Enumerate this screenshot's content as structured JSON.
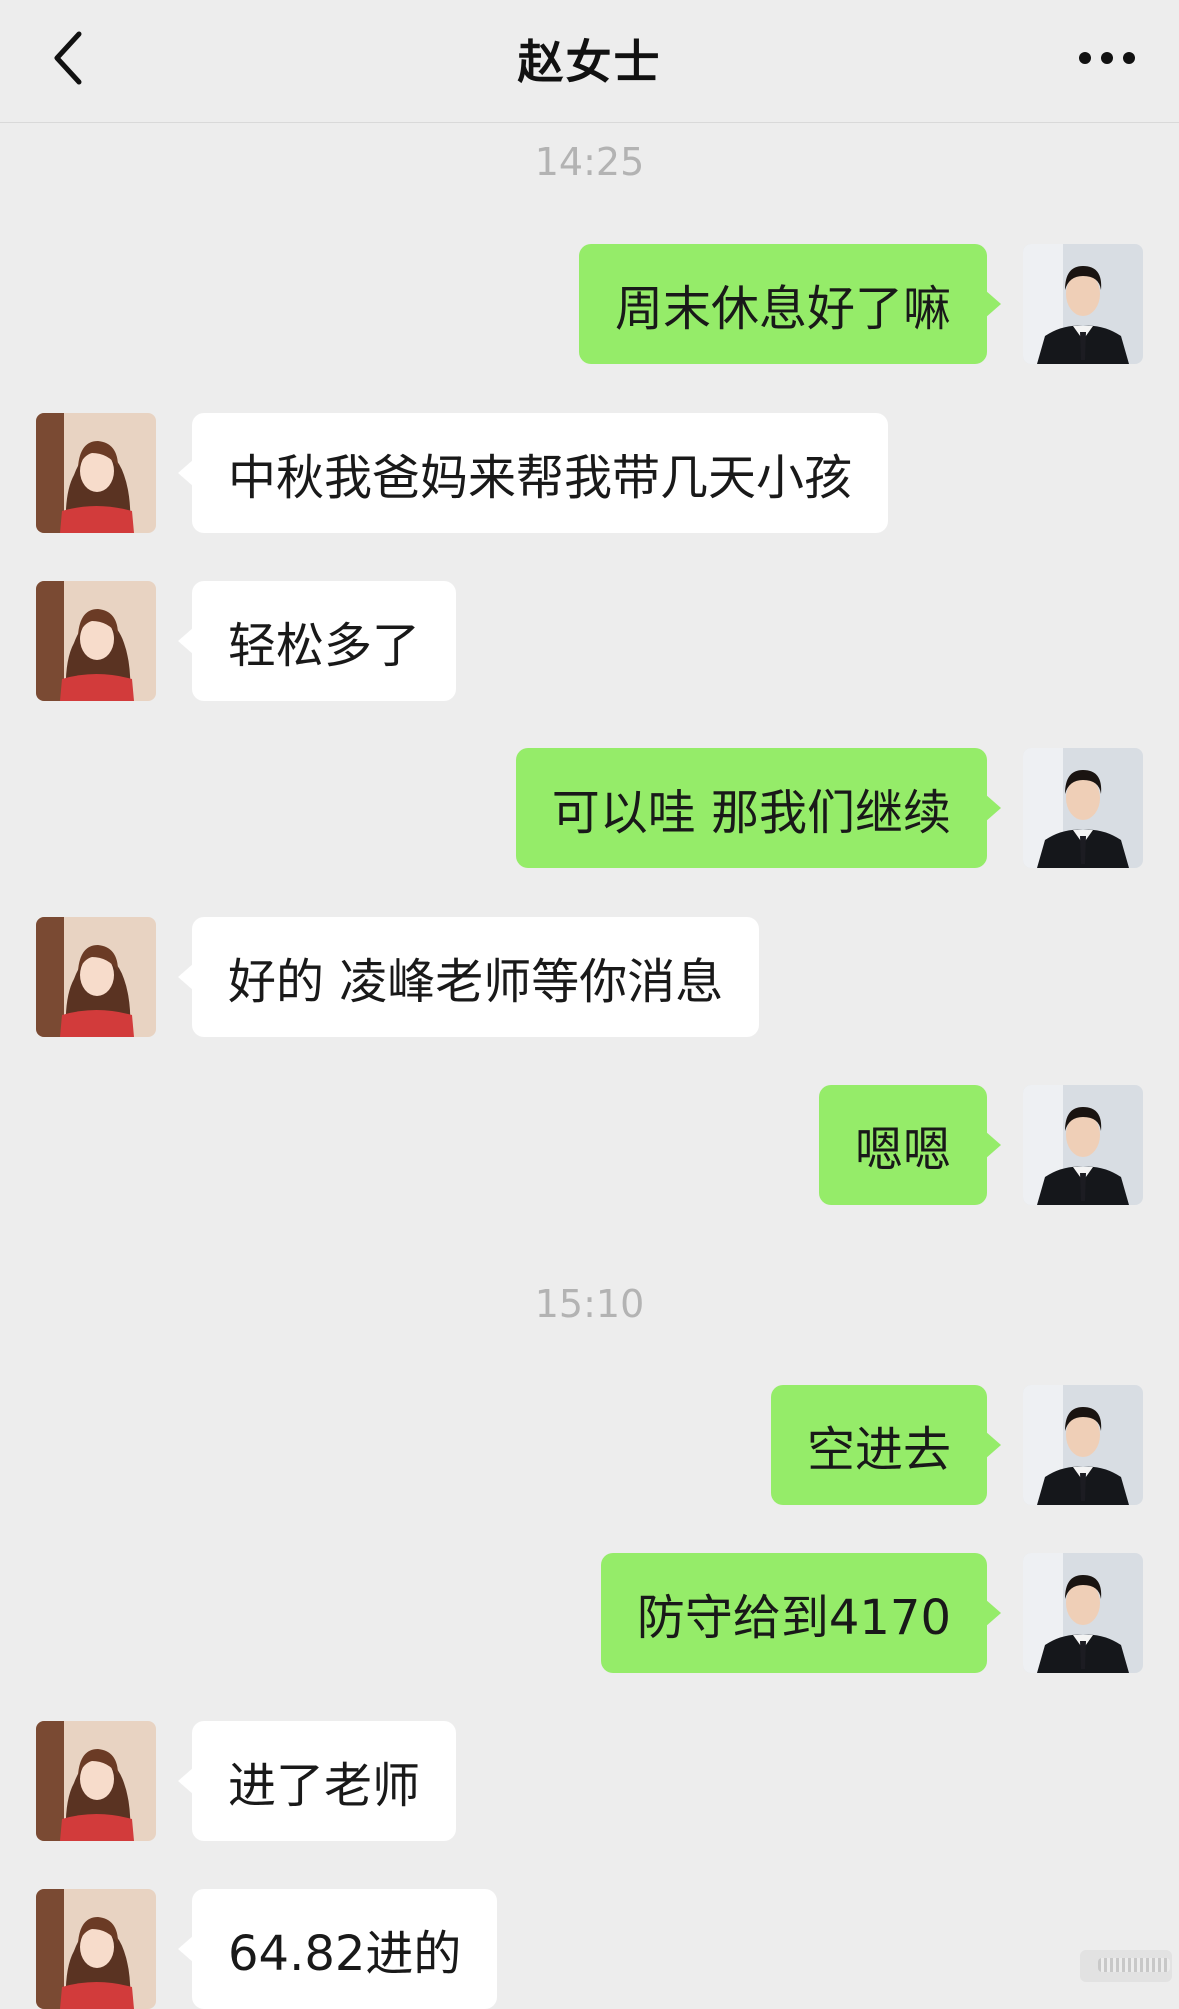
{
  "header": {
    "title": "赵女士",
    "back_icon": "chevron-left-icon",
    "more_icon": "more-dots-icon"
  },
  "colors": {
    "outgoing_bubble": "#95ec69",
    "incoming_bubble": "#ffffff",
    "background": "#ededed"
  },
  "timestamps": [
    "14:25",
    "15:10"
  ],
  "messages": [
    {
      "side": "out",
      "text": "周末休息好了嘛"
    },
    {
      "side": "in",
      "text": "中秋我爸妈来帮我带几天小孩"
    },
    {
      "side": "in",
      "text": "轻松多了"
    },
    {
      "side": "out",
      "text": "可以哇 那我们继续"
    },
    {
      "side": "in",
      "text": "好的 凌峰老师等你消息"
    },
    {
      "side": "out",
      "text": "嗯嗯"
    },
    {
      "side": "out",
      "text": "空进去"
    },
    {
      "side": "out",
      "text": "防守给到4170"
    },
    {
      "side": "in",
      "text": "进了老师"
    },
    {
      "side": "in",
      "text": "64.82进的"
    }
  ]
}
